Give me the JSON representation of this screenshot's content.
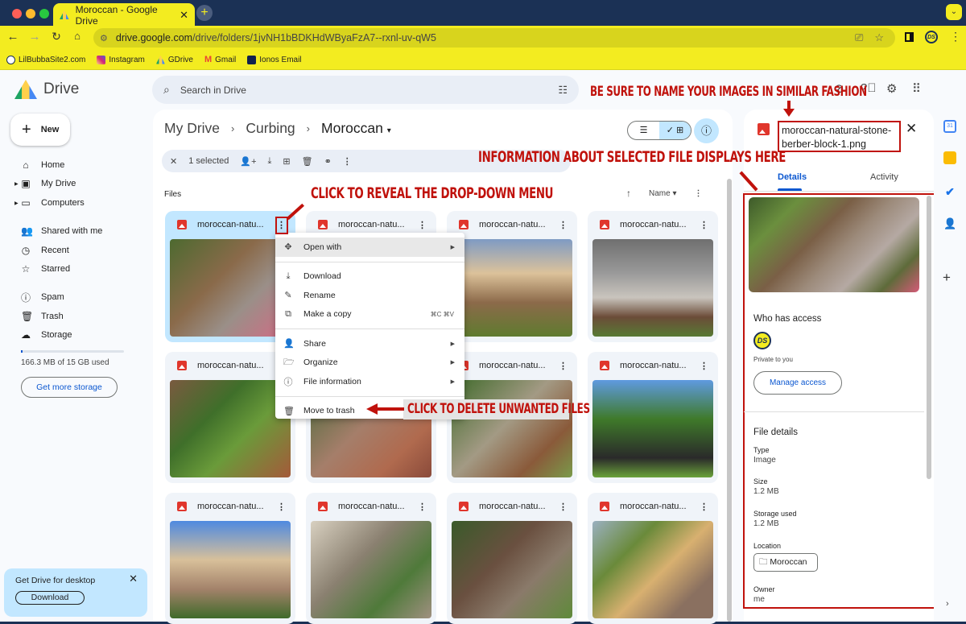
{
  "browser": {
    "tab_title": "Moroccan - Google Drive",
    "tab_close": "✕",
    "new_tab": "+",
    "url_domain": "drive.google.com",
    "url_path": "/drive/folders/1jvNH1bBDKHdWByaFzA7--rxnl-uv-qW5",
    "bookmarks": [
      {
        "label": "LilBubbaSite2.com",
        "icon": "avatar-icon",
        "color": "#1b3155"
      },
      {
        "label": "Instagram",
        "icon": "instagram-icon",
        "color": "#d62976"
      },
      {
        "label": "GDrive",
        "icon": "drive-icon",
        "color": "#1fa463"
      },
      {
        "label": "Gmail",
        "icon": "gmail-icon",
        "color": "#ea4335"
      },
      {
        "label": "Ionos Email",
        "icon": "ionos-icon",
        "color": "#11224d"
      }
    ],
    "accent": "#f3ec20"
  },
  "drive": {
    "app_name": "Drive",
    "new_label": "New",
    "search_placeholder": "Search in Drive",
    "nav": [
      {
        "label": "Home",
        "icon": "home-icon"
      },
      {
        "label": "My Drive",
        "icon": "my-drive-icon"
      },
      {
        "label": "Computers",
        "icon": "computers-icon"
      },
      {
        "label": "Shared with me",
        "icon": "shared-icon"
      },
      {
        "label": "Recent",
        "icon": "clock-icon"
      },
      {
        "label": "Starred",
        "icon": "star-icon"
      },
      {
        "label": "Spam",
        "icon": "spam-icon"
      },
      {
        "label": "Trash",
        "icon": "trash-icon"
      },
      {
        "label": "Storage",
        "icon": "cloud-icon"
      }
    ],
    "storage_text": "166.3 MB of 15 GB used",
    "storage_fraction": 0.011,
    "get_more_storage": "Get more storage",
    "promo_title": "Get Drive for desktop",
    "promo_button": "Download",
    "breadcrumbs": [
      "My Drive",
      "Curbing",
      "Moroccan"
    ],
    "selection_text": "1 selected",
    "files_heading": "Files",
    "sort_label": "Name",
    "avatar_initials": "DS",
    "files": [
      {
        "name": "moroccan-natu...",
        "selected": true
      },
      {
        "name": "moroccan-natu...",
        "selected": false
      },
      {
        "name": "moroccan-natu...",
        "selected": false
      },
      {
        "name": "moroccan-natu...",
        "selected": false
      },
      {
        "name": "moroccan-natu...",
        "selected": false
      },
      {
        "name": "moroccan-natu...",
        "selected": false
      },
      {
        "name": "moroccan-natu...",
        "selected": false
      },
      {
        "name": "moroccan-natu...",
        "selected": false
      },
      {
        "name": "moroccan-natu...",
        "selected": false
      },
      {
        "name": "moroccan-natu...",
        "selected": false
      },
      {
        "name": "moroccan-natu...",
        "selected": false
      },
      {
        "name": "moroccan-natu...",
        "selected": false
      }
    ],
    "context_menu": {
      "open_with": "Open with",
      "download": "Download",
      "rename": "Rename",
      "make_copy": "Make a copy",
      "make_copy_shortcut": "⌘C ⌘V",
      "share": "Share",
      "organize": "Organize",
      "file_information": "File information",
      "move_to_trash": "Move to trash"
    },
    "details_panel": {
      "file_name": "moroccan-natural-stone-berber-block-1.png",
      "tab_details": "Details",
      "tab_activity": "Activity",
      "who_has_access": "Who has access",
      "access_text": "Private to you",
      "manage_access": "Manage access",
      "file_details": "File details",
      "type_label": "Type",
      "type_value": "Image",
      "size_label": "Size",
      "size_value": "1.2 MB",
      "storage_label": "Storage used",
      "storage_value": "1.2 MB",
      "location_label": "Location",
      "location_value": "Moroccan",
      "owner_label": "Owner",
      "owner_value": "me"
    }
  },
  "annotations": {
    "name_images": "BE SURE TO NAME YOUR IMAGES IN SIMILAR FASHION",
    "info_displays": "INFORMATION ABOUT SELECTED FILE DISPLAYS HERE",
    "reveal_menu": "CLICK TO REVEAL THE DROP-DOWN MENU",
    "delete_files": "CLICK TO DELETE UNWANTED FILES",
    "color": "#c0120c"
  }
}
